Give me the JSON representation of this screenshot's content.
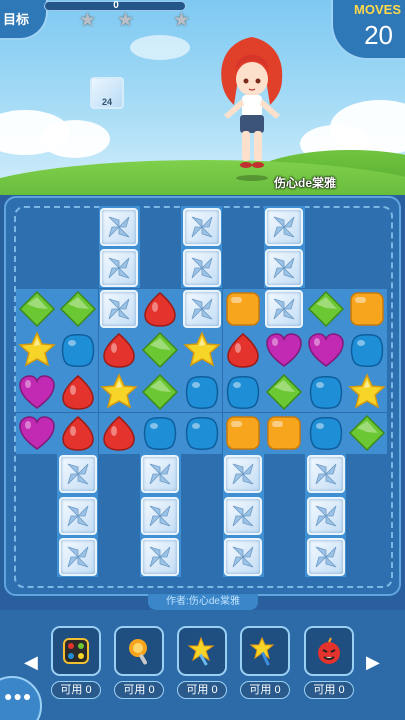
{
  "hud": {
    "goal_label": "目标",
    "score": "0",
    "score_progress": 0,
    "stars_earned": 0,
    "moves_label": "MOVES",
    "moves": "20",
    "goal_block_count": "24",
    "character_name": "伤心de棠雅"
  },
  "board": {
    "author_label": "作者:伤心de棠雅",
    "rows": [
      [
        "",
        "",
        "B",
        "",
        "B",
        "",
        "B",
        "",
        ""
      ],
      [
        "",
        "",
        "B",
        "",
        "B",
        "",
        "B",
        "",
        ""
      ],
      [
        "G",
        "G",
        "B",
        "R",
        "B",
        "O",
        "B",
        "G",
        "O"
      ],
      [
        "Y",
        "L",
        "R",
        "G",
        "Y",
        "R",
        "P",
        "P",
        "L"
      ],
      [
        "P",
        "R",
        "Y",
        "G",
        "L",
        "L",
        "G",
        "L",
        "Y"
      ],
      [
        "P",
        "R",
        "R",
        "L",
        "L",
        "O",
        "O",
        "L",
        "G"
      ],
      [
        "",
        "B",
        "",
        "B",
        "",
        "B",
        "",
        "B",
        ""
      ],
      [
        "",
        "B",
        "",
        "B",
        "",
        "B",
        "",
        "B",
        ""
      ],
      [
        "",
        "B",
        "",
        "B",
        "",
        "B",
        "",
        "B",
        ""
      ]
    ],
    "legend": {
      "G": "green-diamond-candy",
      "R": "red-drop-candy",
      "O": "orange-square-candy",
      "Y": "yellow-star-candy",
      "L": "blue-round-candy",
      "P": "purple-heart-candy",
      "B": "ice-blocker"
    },
    "colors": {
      "G": "#6cc832",
      "R": "#e4322c",
      "O": "#f7a51c",
      "Y": "#f7d428",
      "L": "#1e8fd6",
      "P": "#c22ab4"
    }
  },
  "boosters": [
    {
      "name": "color-shuffle-booster",
      "label": "可用 0"
    },
    {
      "name": "hammer-booster",
      "label": "可用 0"
    },
    {
      "name": "star-wand-booster",
      "label": "可用 0"
    },
    {
      "name": "magic-wand-booster",
      "label": "可用 0"
    },
    {
      "name": "bomb-booster",
      "label": "可用 0"
    }
  ]
}
